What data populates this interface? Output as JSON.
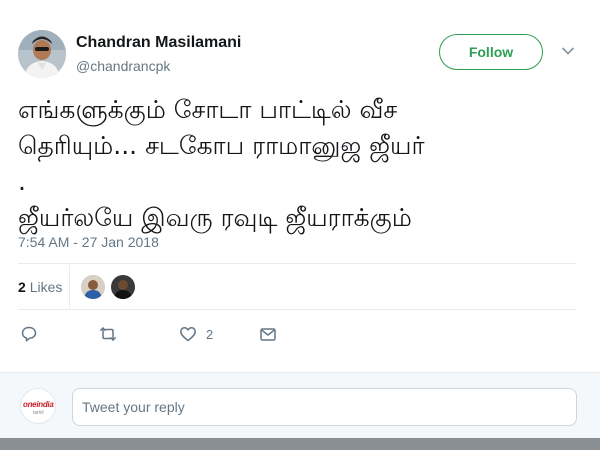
{
  "author": {
    "name": "Chandran Masilamani",
    "handle": "@chandrancpk"
  },
  "follow_label": "Follow",
  "tweet": {
    "text": "எங்களுக்கும் சோடா பாட்டில் வீச\nதெரியும்... சடகோப ராமானுஜ ஜீயர்\n.\nஜீயர்லயே இவரு ரவுடி ஜீயராக்கும்",
    "timestamp": "7:54 AM - 27 Jan 2018"
  },
  "stats": {
    "likes_count": "2",
    "likes_label": "Likes"
  },
  "actions": {
    "like_count": "2"
  },
  "reply": {
    "placeholder": "Tweet your reply",
    "logo_text_main": "oneindia",
    "logo_text_sub": "tamil"
  },
  "icons": [
    "chevron-down-icon",
    "reply-icon",
    "retweet-icon",
    "heart-icon",
    "message-icon"
  ],
  "colors": {
    "follow_accent": "#2e9e54",
    "secondary_text": "#657786",
    "reply_bg": "#f5f8fa"
  }
}
